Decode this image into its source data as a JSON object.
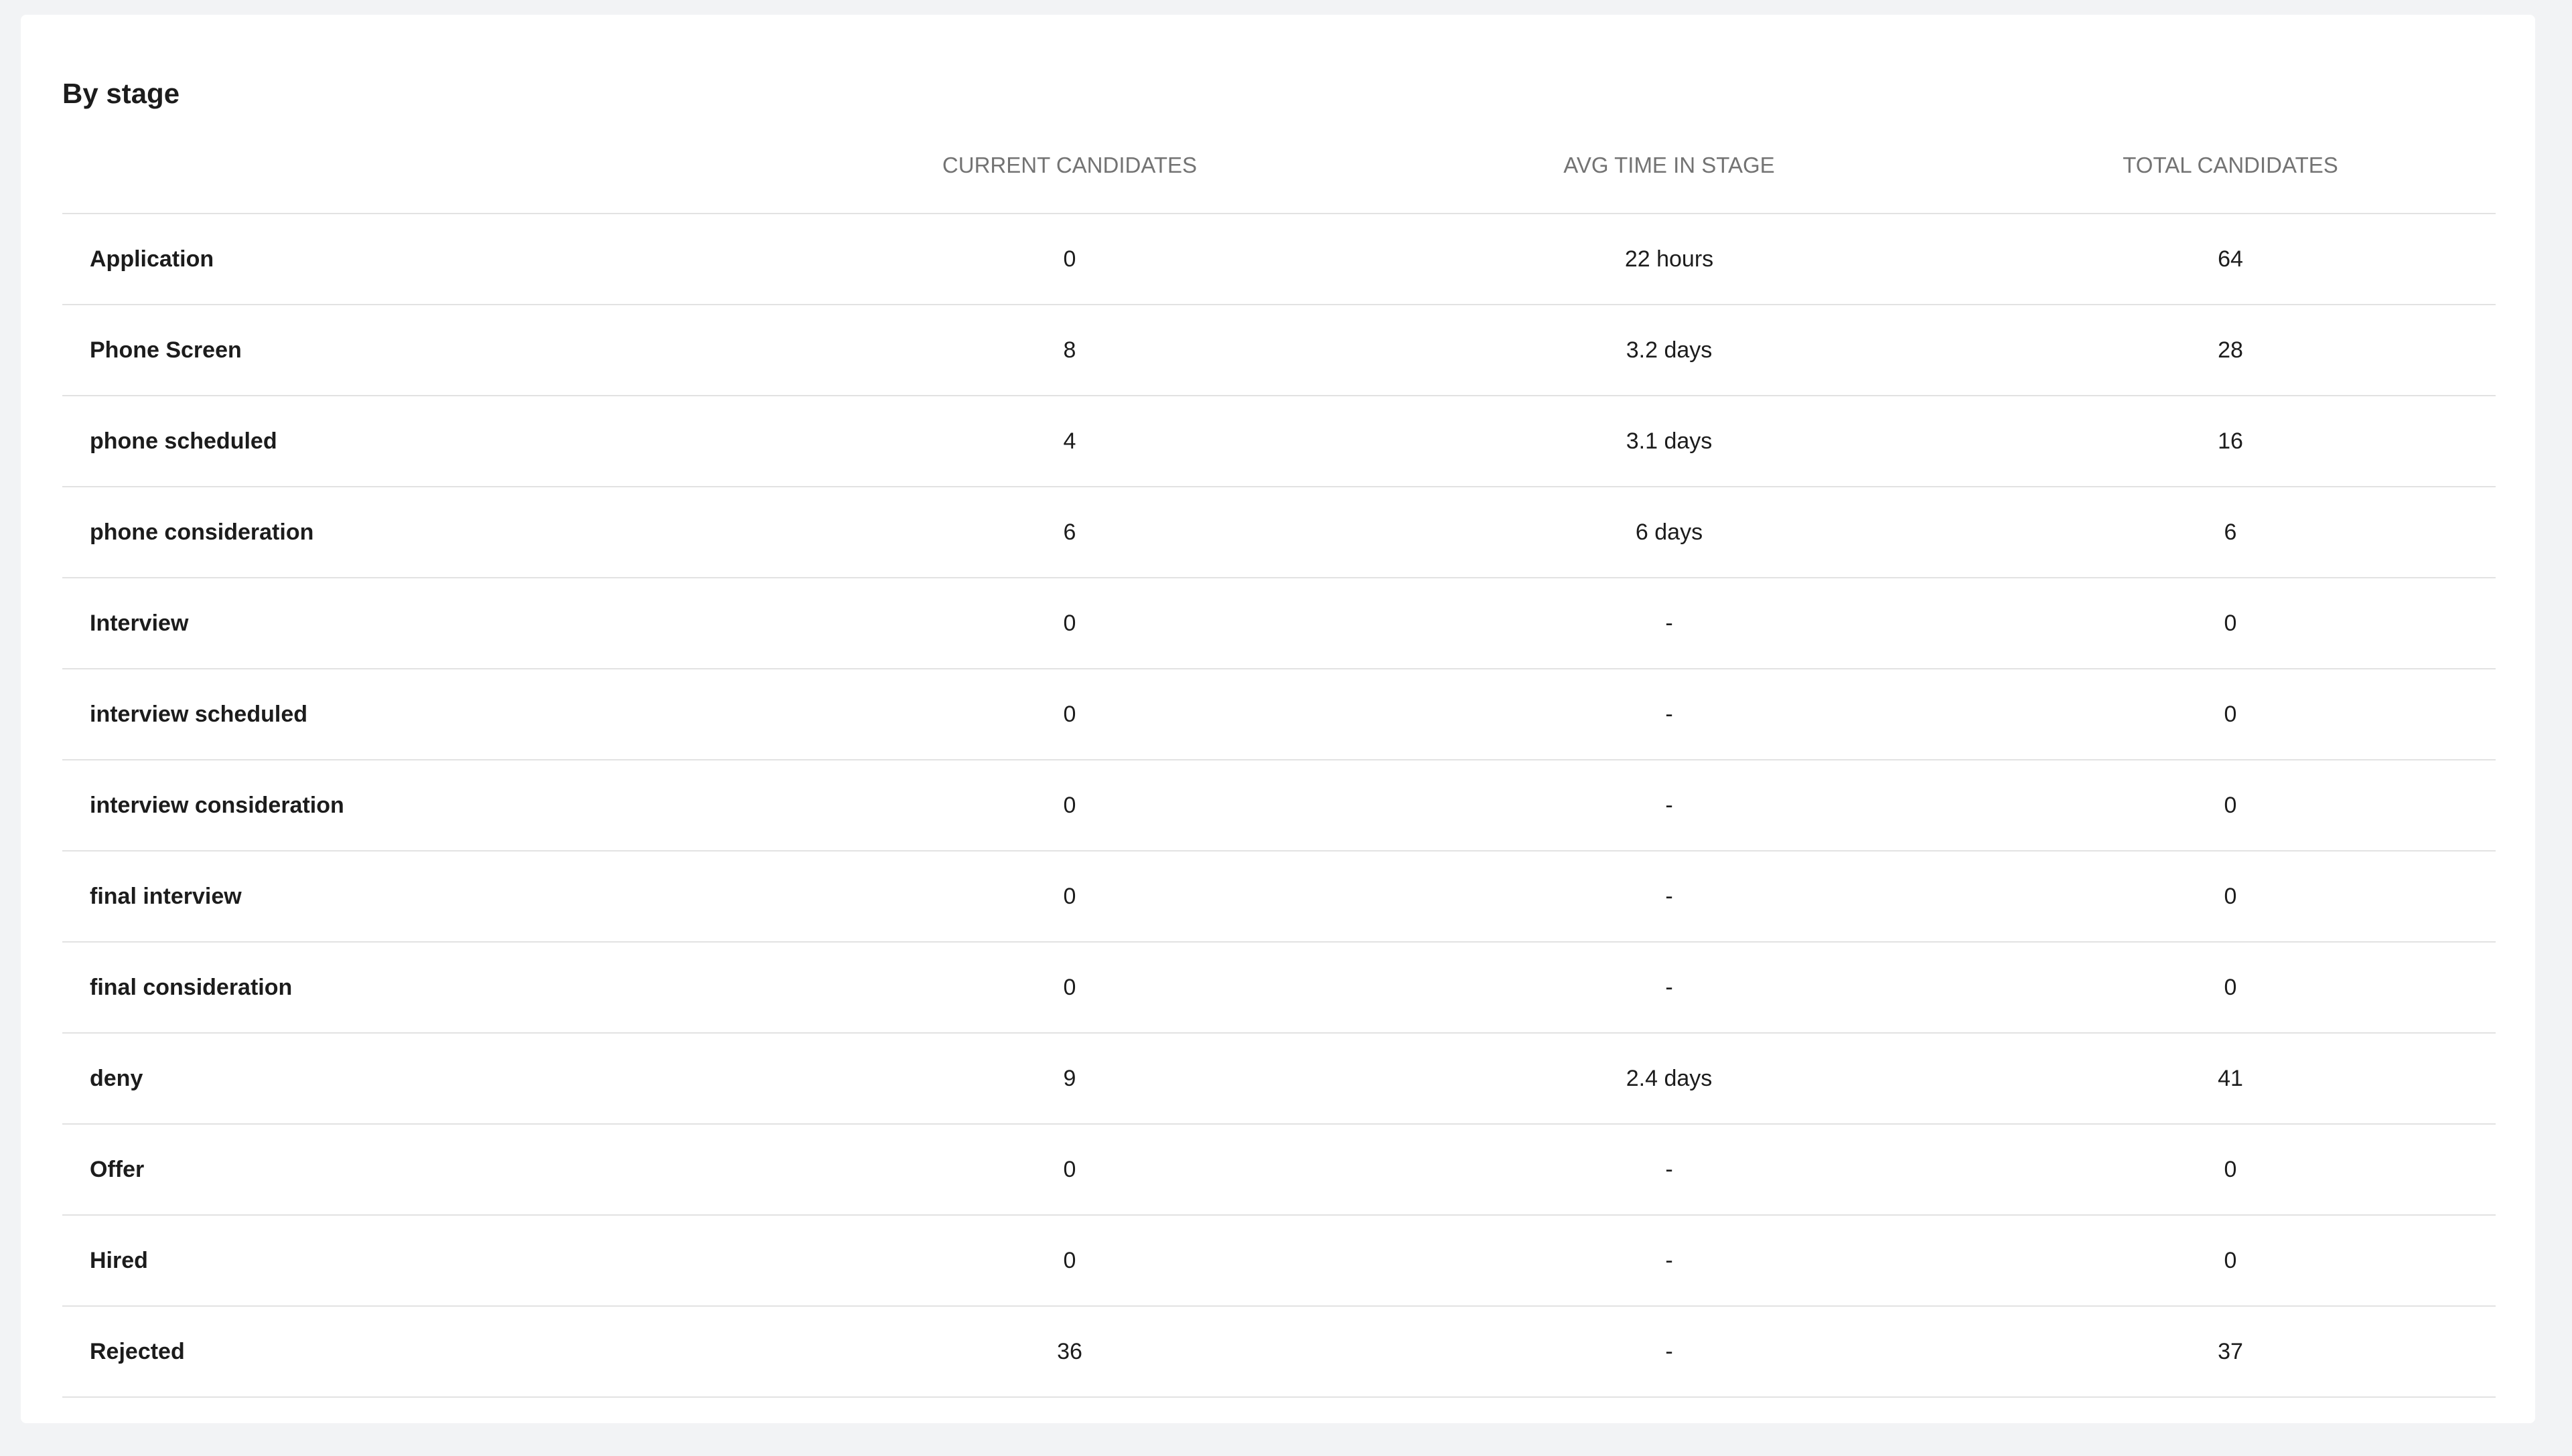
{
  "title": "By stage",
  "columns": {
    "current": "CURRENT CANDIDATES",
    "avg": "AVG TIME IN STAGE",
    "total": "TOTAL CANDIDATES"
  },
  "rows": [
    {
      "stage": "Application",
      "current": "0",
      "avg": "22 hours",
      "total": "64"
    },
    {
      "stage": "Phone Screen",
      "current": "8",
      "avg": "3.2 days",
      "total": "28"
    },
    {
      "stage": "phone scheduled",
      "current": "4",
      "avg": "3.1 days",
      "total": "16"
    },
    {
      "stage": "phone consideration",
      "current": "6",
      "avg": "6 days",
      "total": "6"
    },
    {
      "stage": "Interview",
      "current": "0",
      "avg": "-",
      "total": "0"
    },
    {
      "stage": "interview scheduled",
      "current": "0",
      "avg": "-",
      "total": "0"
    },
    {
      "stage": "interview consideration",
      "current": "0",
      "avg": "-",
      "total": "0"
    },
    {
      "stage": "final interview",
      "current": "0",
      "avg": "-",
      "total": "0"
    },
    {
      "stage": "final consideration",
      "current": "0",
      "avg": "-",
      "total": "0"
    },
    {
      "stage": "deny",
      "current": "9",
      "avg": "2.4 days",
      "total": "41"
    },
    {
      "stage": "Offer",
      "current": "0",
      "avg": "-",
      "total": "0"
    },
    {
      "stage": "Hired",
      "current": "0",
      "avg": "-",
      "total": "0"
    },
    {
      "stage": "Rejected",
      "current": "36",
      "avg": "-",
      "total": "37"
    }
  ]
}
